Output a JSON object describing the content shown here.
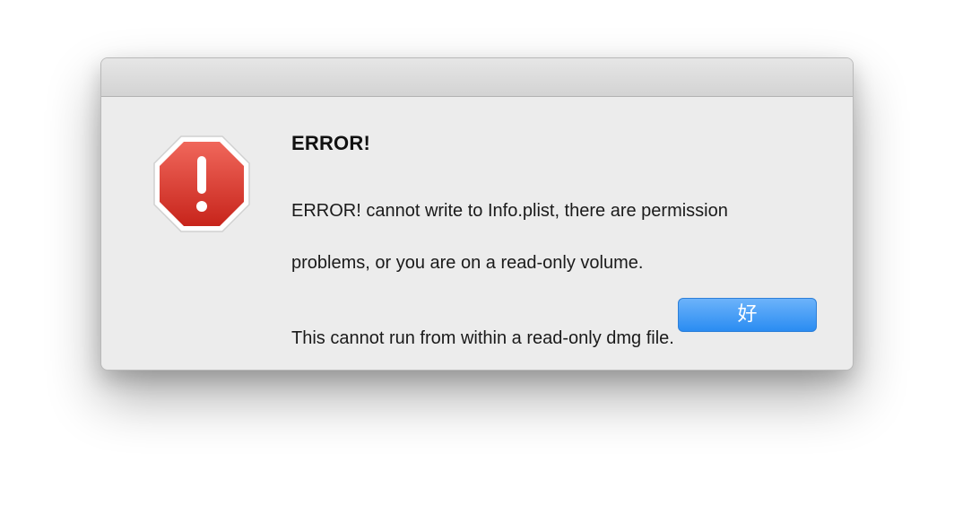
{
  "dialog": {
    "title_text": "ERROR!",
    "message_lines": [
      "ERROR! cannot write to Info.plist, there are permission",
      "problems, or you are on a read-only volume."
    ],
    "info_text": "This cannot run from within a read-only dmg file.",
    "icon": "stop-sign-exclamation-icon",
    "ok_label": "好"
  },
  "colors": {
    "dialog_bg": "#ececec",
    "titlebar_bg": "#d9d9d9",
    "button_blue": "#3a97f5",
    "stop_red": "#e53d2f"
  }
}
